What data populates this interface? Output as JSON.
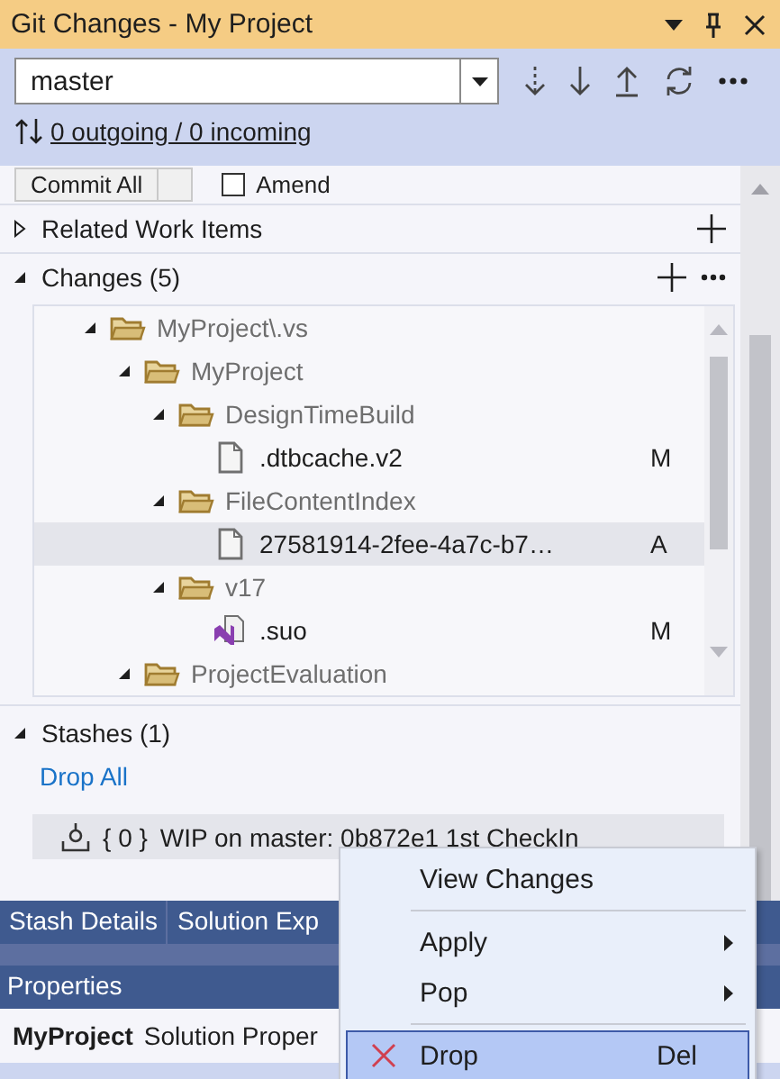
{
  "window": {
    "title": "Git Changes - My Project"
  },
  "branch": {
    "value": "master"
  },
  "sync_link": "0 outgoing / 0 incoming",
  "commit": {
    "button": "Commit All",
    "amend": {
      "label": "Amend",
      "checked": false
    }
  },
  "related_work_items": {
    "title": "Related Work Items",
    "expanded": false
  },
  "changes": {
    "title": "Changes (5)",
    "expanded": true,
    "tree": [
      {
        "kind": "folder",
        "name": "MyProject\\.vs",
        "expanded": true,
        "selected": false,
        "children": [
          {
            "kind": "folder",
            "name": "MyProject",
            "expanded": true,
            "selected": false,
            "children": [
              {
                "kind": "folder",
                "name": "DesignTimeBuild",
                "expanded": true,
                "selected": false,
                "children": [
                  {
                    "kind": "file",
                    "name": ".dtbcache.v2",
                    "status": "M",
                    "selected": false
                  }
                ]
              },
              {
                "kind": "folder",
                "name": "FileContentIndex",
                "expanded": true,
                "selected": false,
                "children": [
                  {
                    "kind": "file",
                    "name": "27581914-2fee-4a7c-b7…",
                    "status": "A",
                    "selected": true
                  }
                ]
              },
              {
                "kind": "folder",
                "name": "v17",
                "expanded": true,
                "selected": false,
                "children": [
                  {
                    "kind": "vs-file",
                    "name": ".suo",
                    "status": "M",
                    "selected": false
                  }
                ]
              }
            ]
          },
          {
            "kind": "folder",
            "name": "ProjectEvaluation",
            "expanded": true,
            "selected": false
          }
        ]
      }
    ]
  },
  "stashes": {
    "title": "Stashes (1)",
    "expanded": true,
    "drop_all": "Drop All",
    "items": [
      {
        "index": "{ 0 }",
        "message": "WIP on master: 0b872e1 1st CheckIn"
      }
    ]
  },
  "tool_tabs": [
    {
      "label": "Stash Details"
    },
    {
      "label": "Solution Exp"
    }
  ],
  "properties": {
    "title": "Properties",
    "object": "MyProject",
    "type": "Solution Proper"
  },
  "context_menu": [
    {
      "kind": "item",
      "label": "View Changes",
      "selected": false
    },
    {
      "kind": "separator"
    },
    {
      "kind": "submenu",
      "label": "Apply",
      "selected": false
    },
    {
      "kind": "submenu",
      "label": "Pop",
      "selected": false
    },
    {
      "kind": "separator"
    },
    {
      "kind": "delete",
      "label": "Drop",
      "shortcut": "Del",
      "selected": true
    }
  ]
}
